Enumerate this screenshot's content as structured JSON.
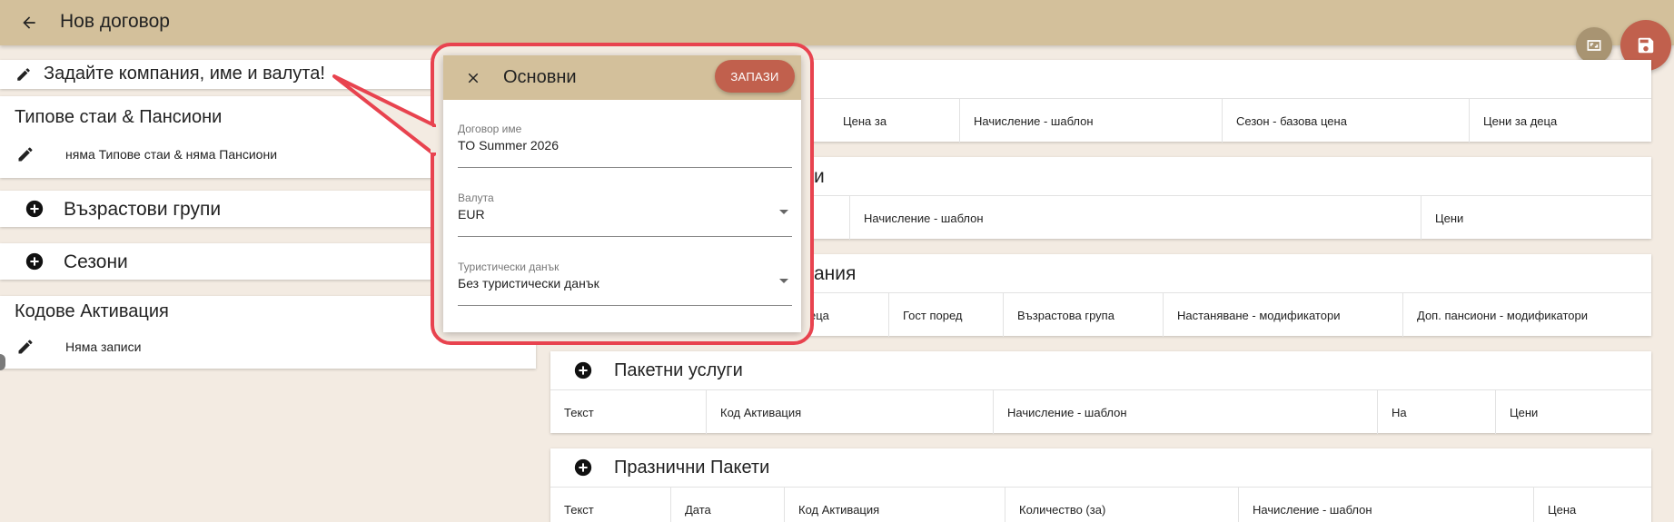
{
  "header": {
    "title": "Нов договор"
  },
  "left": {
    "company_label": "Задайте компания, име и валута!",
    "room_types": {
      "title": "Типове стаи & Пансиони",
      "row": "няма Типове стаи & няма Пансиони"
    },
    "age_groups": {
      "title": "Възрастови групи"
    },
    "seasons": {
      "title": "Сезони"
    },
    "activation_codes": {
      "title": "Кодове Активация",
      "row": "Няма записи"
    }
  },
  "right": {
    "card1": {
      "cols": [
        "Цена за",
        "Начисление - шаблон",
        "Сезон - базова цена",
        "Цени за деца"
      ]
    },
    "card2": {
      "title_fragment": "и",
      "cols": [
        "Начисление - шаблон",
        "Цени"
      ]
    },
    "card3": {
      "title_fragment": "ания",
      "cols": [
        "еца",
        "Гост поред",
        "Възрастова група",
        "Настаняване - модификатори",
        "Доп. пансиони - модификатори"
      ]
    },
    "packages": {
      "title": "Пакетни услуги",
      "cols": [
        "Текст",
        "Код Активация",
        "Начисление - шаблон",
        "На",
        "Цени"
      ]
    },
    "holiday": {
      "title": "Празнични Пакети",
      "cols": [
        "Текст",
        "Дата",
        "Код Активация",
        "Количество (за)",
        "Начисление - шаблон",
        "Цена"
      ]
    }
  },
  "dialog": {
    "title": "Основни",
    "save_label": "ЗАПАЗИ",
    "fields": [
      {
        "label": "Договор име",
        "value": "TO Summer 2026"
      },
      {
        "label": "Валута",
        "value": "EUR"
      },
      {
        "label": "Туристически данък",
        "value": "Без туристически данък"
      }
    ]
  },
  "colors": {
    "header": "#d3c09b",
    "accent": "#c1604d",
    "highlight": "#e8434f",
    "background": "#f3ebe2"
  }
}
